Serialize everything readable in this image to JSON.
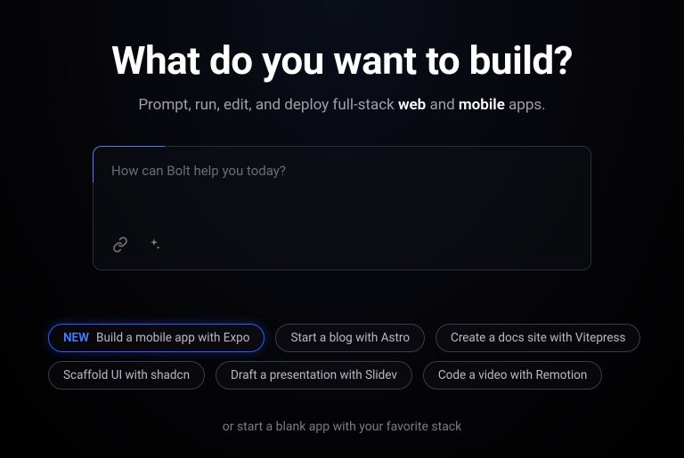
{
  "headline": "What do you want to build?",
  "subhead": {
    "pre": "Prompt, run, edit, and deploy full-stack ",
    "strong1": "web",
    "mid": " and ",
    "strong2": "mobile",
    "post": " apps."
  },
  "prompt": {
    "placeholder": "How can Bolt help you today?"
  },
  "chips": {
    "featured_badge": "NEW",
    "featured_label": "Build a mobile app with Expo",
    "items": [
      "Start a blog with Astro",
      "Create a docs site with Vitepress",
      "Scaffold UI with shadcn",
      "Draft a presentation with Slidev",
      "Code a video with Remotion"
    ]
  },
  "footnote": "or start a blank app with your favorite stack"
}
